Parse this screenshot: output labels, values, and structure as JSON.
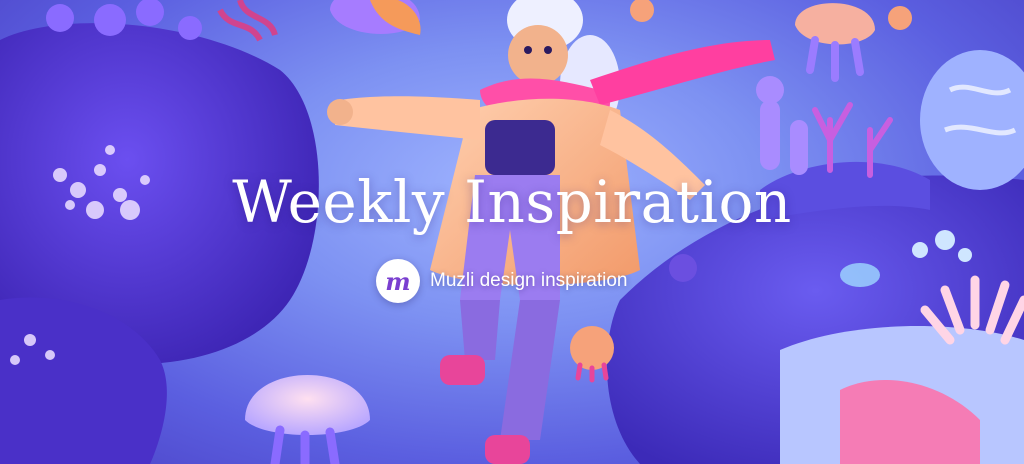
{
  "hero": {
    "title": "Weekly Inspiration",
    "brand_logo_letter": "m",
    "brand_name": "Muzli design inspiration"
  },
  "colors": {
    "background": "#7d91f2",
    "rock_purple": "#5a3fd8",
    "accent_pink": "#e8459a",
    "accent_orange": "#f4a070"
  }
}
